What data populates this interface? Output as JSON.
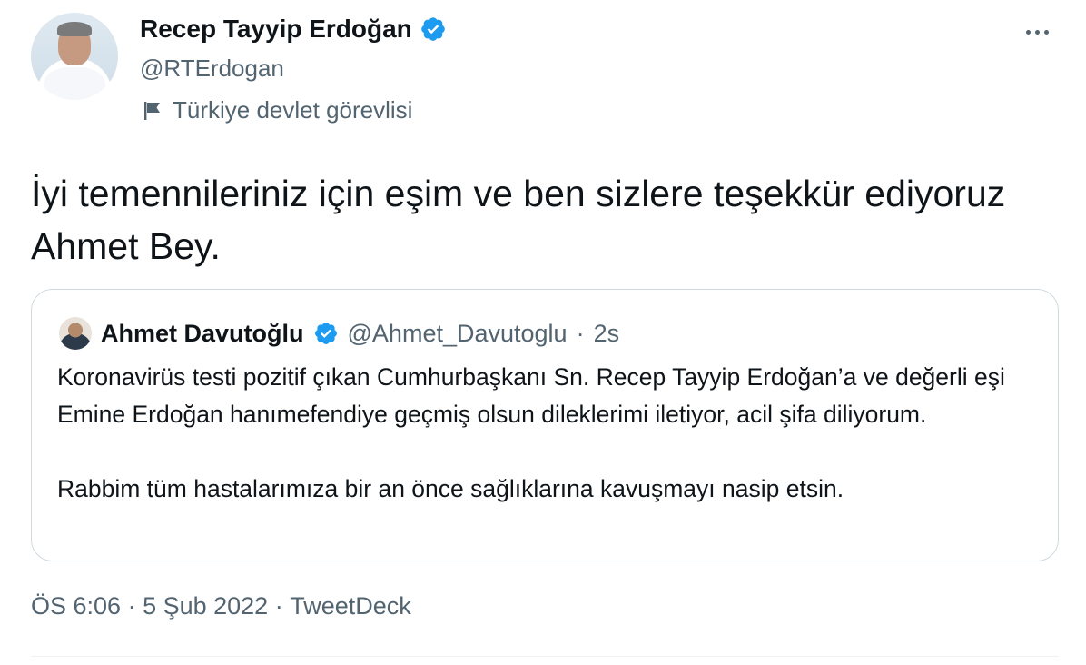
{
  "author": {
    "display_name": "Recep Tayyip Erdoğan",
    "handle": "@RTErdogan",
    "label": "Türkiye devlet görevlisi",
    "verified": true
  },
  "tweet": {
    "text": "İyi temennileriniz için eşim ve ben sizlere teşekkür ediyoruz Ahmet Bey."
  },
  "quoted": {
    "display_name": "Ahmet Davutoğlu",
    "handle": "@Ahmet_Davutoglu",
    "time": "2s",
    "separator": "·",
    "paragraphs": [
      "Koronavirüs testi pozitif çıkan Cumhurbaşkanı Sn. Recep Tayyip Erdoğan’a ve değerli eşi Emine Erdoğan hanımefendiye geçmiş olsun dileklerimi iletiyor, acil şifa diliyorum.",
      "Rabbim tüm hastalarımıza bir an önce sağlıklarına kavuşmayı nasip etsin."
    ]
  },
  "footer": {
    "time": "ÖS 6:06",
    "date": "5 Şub 2022",
    "source": "TweetDeck",
    "separator": " · "
  },
  "colors": {
    "text": "#0f1419",
    "secondary": "#536471",
    "verified_badge": "#1d9bf0",
    "border": "#cfd9de"
  },
  "icons": [
    "avatar",
    "verified-badge-icon",
    "flag-icon",
    "more-icon"
  ]
}
